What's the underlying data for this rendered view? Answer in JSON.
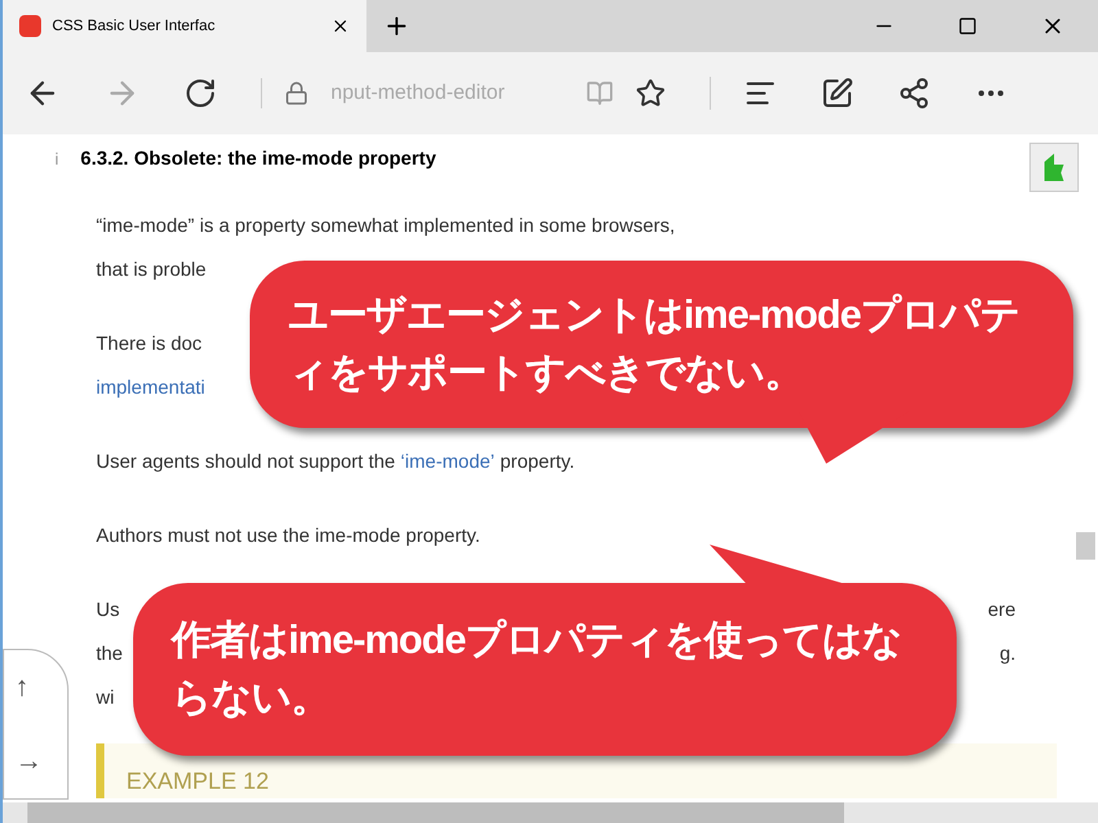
{
  "tab": {
    "title": "CSS Basic User Interfac",
    "selected": true
  },
  "address": {
    "text": "nput-method-editor"
  },
  "content": {
    "heading_marker": "i",
    "heading": "6.3.2. Obsolete: the ime-mode property",
    "lines": [
      {
        "kind": "text",
        "parts": [
          {
            "text": "“ime-mode” is a property somewhat implemented in some browsers,",
            "link": false
          }
        ]
      },
      {
        "kind": "text",
        "parts": [
          {
            "text": "that is proble",
            "link": false
          }
        ]
      },
      {
        "kind": "text",
        "parts": [
          {
            "text": "There is doc",
            "link": false
          }
        ]
      },
      {
        "kind": "text",
        "parts": [
          {
            "text": "implementati",
            "link": true
          }
        ]
      },
      {
        "kind": "text",
        "parts": [
          {
            "text": "User agents should not support the",
            "link": false
          },
          {
            "text": "‘ime-mode’",
            "link": true
          },
          {
            "text": "property.",
            "link": false
          }
        ]
      },
      {
        "kind": "text",
        "parts": [
          {
            "text": "Authors must not use the ime-mode property.",
            "link": false
          }
        ]
      },
      {
        "kind": "split",
        "left": "Us",
        "right": "ere"
      },
      {
        "kind": "split",
        "left": "the",
        "right": "g."
      },
      {
        "kind": "text",
        "parts": [
          {
            "text": "wi",
            "link": false
          }
        ]
      }
    ],
    "example": "EXAMPLE 12"
  },
  "side_buttons": [
    "↑",
    "→"
  ],
  "callouts": [
    "ユーザエージェントはime-modeプロパティをサポートすべきでない。",
    "作者はime-modeプロパティを使ってはならない。"
  ]
}
